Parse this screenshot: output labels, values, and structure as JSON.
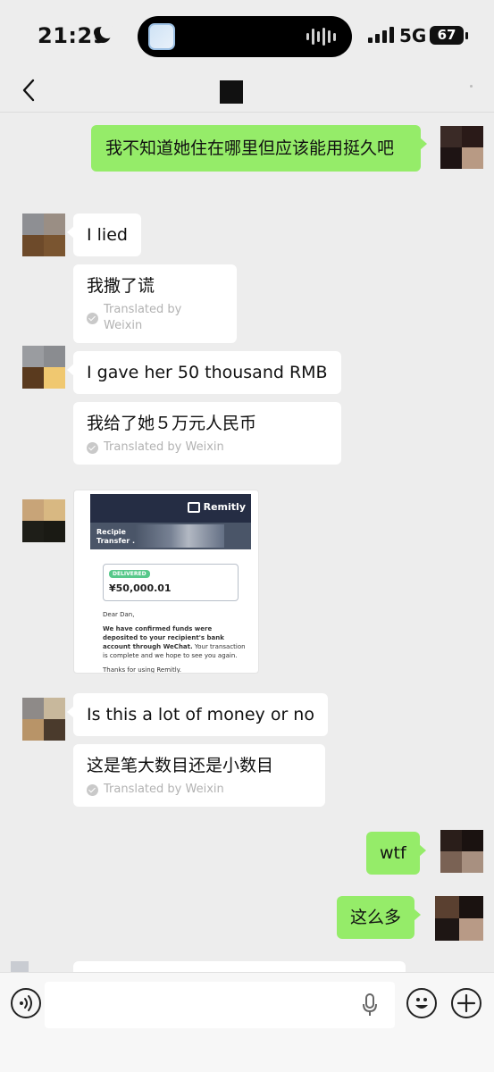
{
  "status_bar": {
    "time": "21:29",
    "network": "5G",
    "battery": "67"
  },
  "icons": {
    "back": "chevron-left-icon",
    "moon": "moon-icon",
    "voice": "voice-input-icon",
    "mic": "microphone-icon",
    "emoji": "emoji-icon",
    "add": "plus-circle-icon"
  },
  "messages": [
    {
      "side": "right",
      "text": "我不知道她住在哪里但应该能用挺久吧"
    },
    {
      "side": "left",
      "text": "I lied",
      "translation": "我撒了谎",
      "translated_by": "Translated by Weixin"
    },
    {
      "side": "left",
      "text": "I gave her 50 thousand RMB",
      "translation": "我给了她５万元人民币",
      "translated_by": "Translated by Weixin"
    },
    {
      "side": "left",
      "type": "image"
    },
    {
      "side": "left",
      "text": "Is this a lot of money or no",
      "translation": "这是笔大数目还是小数目",
      "translated_by": "Translated by Weixin"
    },
    {
      "side": "right",
      "text": "wtf"
    },
    {
      "side": "right",
      "text": "这么多"
    }
  ],
  "remitly_card": {
    "brand": "Remitly",
    "sub_line1": "Recipie",
    "sub_line2": "Transfer .",
    "status": "DELIVERED",
    "amount": "¥50,000.01",
    "greeting": "Dear Dan,",
    "body_bold": "We have confirmed funds were deposited to your recipient's bank account through WeChat.",
    "body_rest": " Your transaction is complete and we hope to see you again.",
    "thanks": "Thanks for using Remitly."
  },
  "input": {
    "value": "",
    "placeholder": ""
  },
  "colors": {
    "green_bubble": "#95ec69",
    "background": "#ededed",
    "white_bubble": "#ffffff"
  }
}
